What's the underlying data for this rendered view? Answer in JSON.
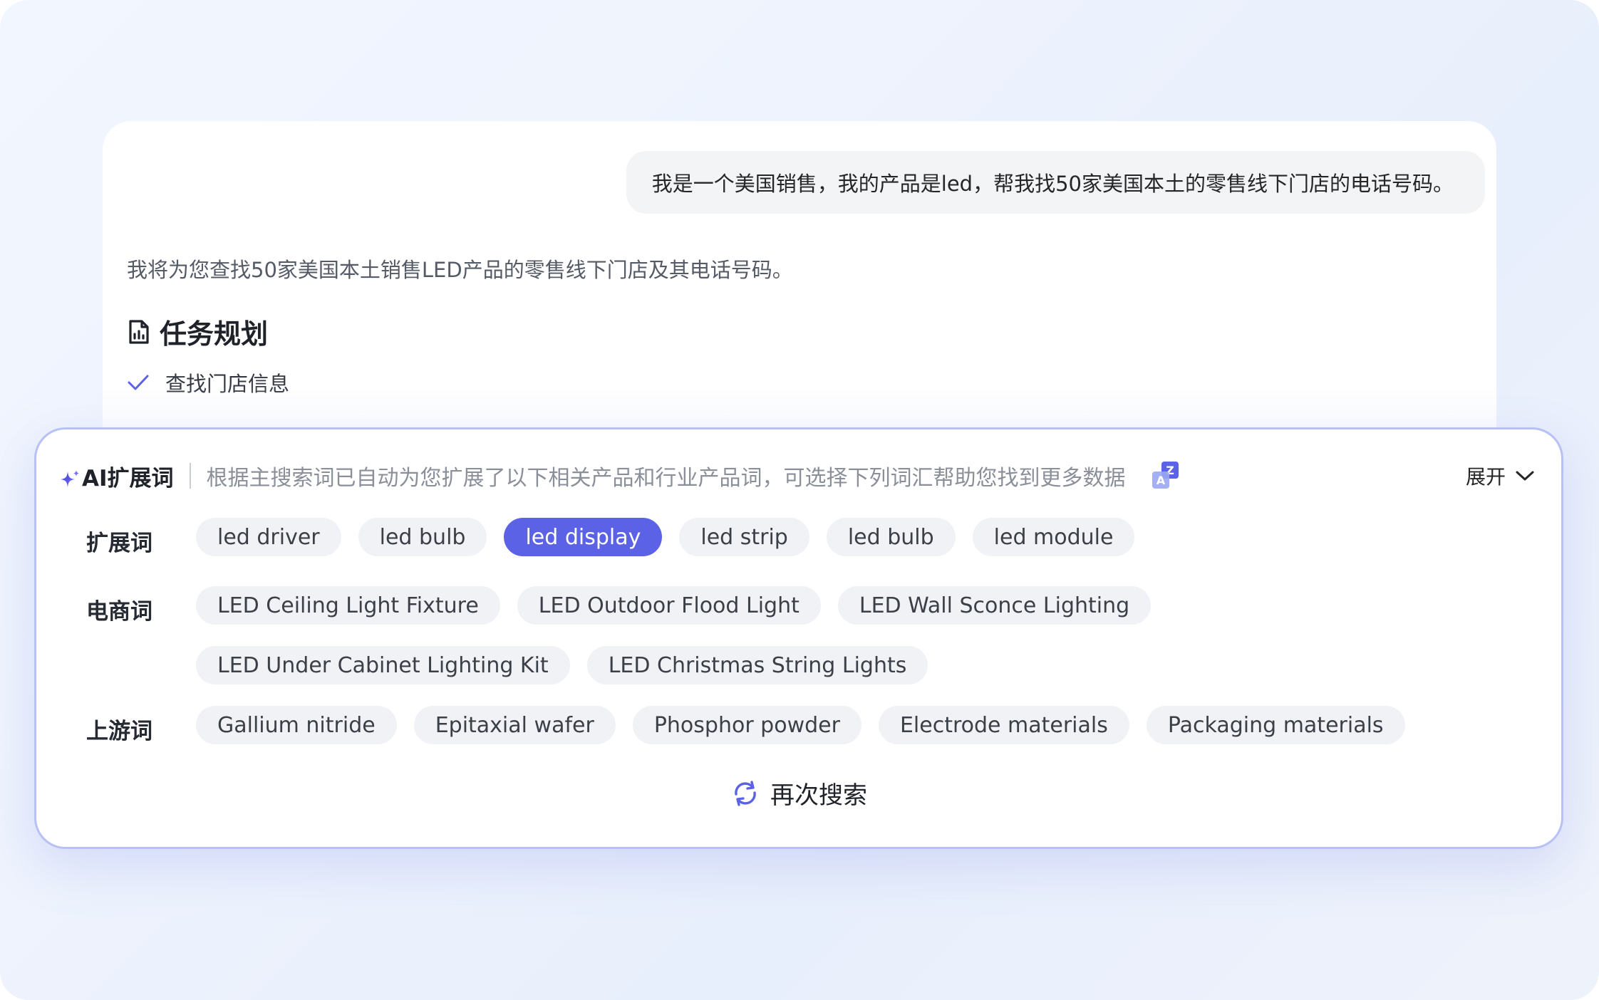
{
  "chat": {
    "user_message": "我是一个美国销售，我的产品是led，帮我找50家美国本土的零售线下门店的电话号码。",
    "assistant_reply": "我将为您查找50家美国本土销售LED产品的零售线下门店及其电话号码。",
    "task_plan": {
      "title": "任务规划",
      "items": [
        {
          "label": "查找门店信息",
          "done": true
        }
      ]
    }
  },
  "panel": {
    "ai_label": "AI扩展词",
    "description": "根据主搜索词已自动为您扩展了以下相关产品和行业产品词，可选择下列词汇帮助您找到更多数据",
    "expand_label": "展开",
    "rows": [
      {
        "label": "扩展词",
        "chips": [
          "led driver",
          "led bulb",
          "led display",
          "led strip",
          "led bulb",
          "led module"
        ],
        "active_index": 2
      },
      {
        "label": "电商词",
        "chips": [
          "LED Ceiling Light Fixture",
          "LED Outdoor Flood Light",
          "LED Wall Sconce Lighting",
          "LED Under Cabinet Lighting Kit",
          "LED Christmas String Lights"
        ]
      },
      {
        "label": "上游词",
        "chips": [
          "Gallium nitride",
          "Epitaxial wafer",
          "Phosphor powder",
          "Electrode materials",
          "Packaging materials"
        ]
      }
    ],
    "research_label": "再次搜索"
  },
  "colors": {
    "accent": "#5b62e5",
    "panel_border": "#b8c0f5",
    "chip_bg": "#f1f2f5"
  },
  "icons": {
    "task_plan": "document-chart-icon",
    "check": "check-icon",
    "ai": "sparkle-icon",
    "translate": "translate-icon",
    "expand": "chevron-down-icon",
    "research": "refresh-icon"
  }
}
